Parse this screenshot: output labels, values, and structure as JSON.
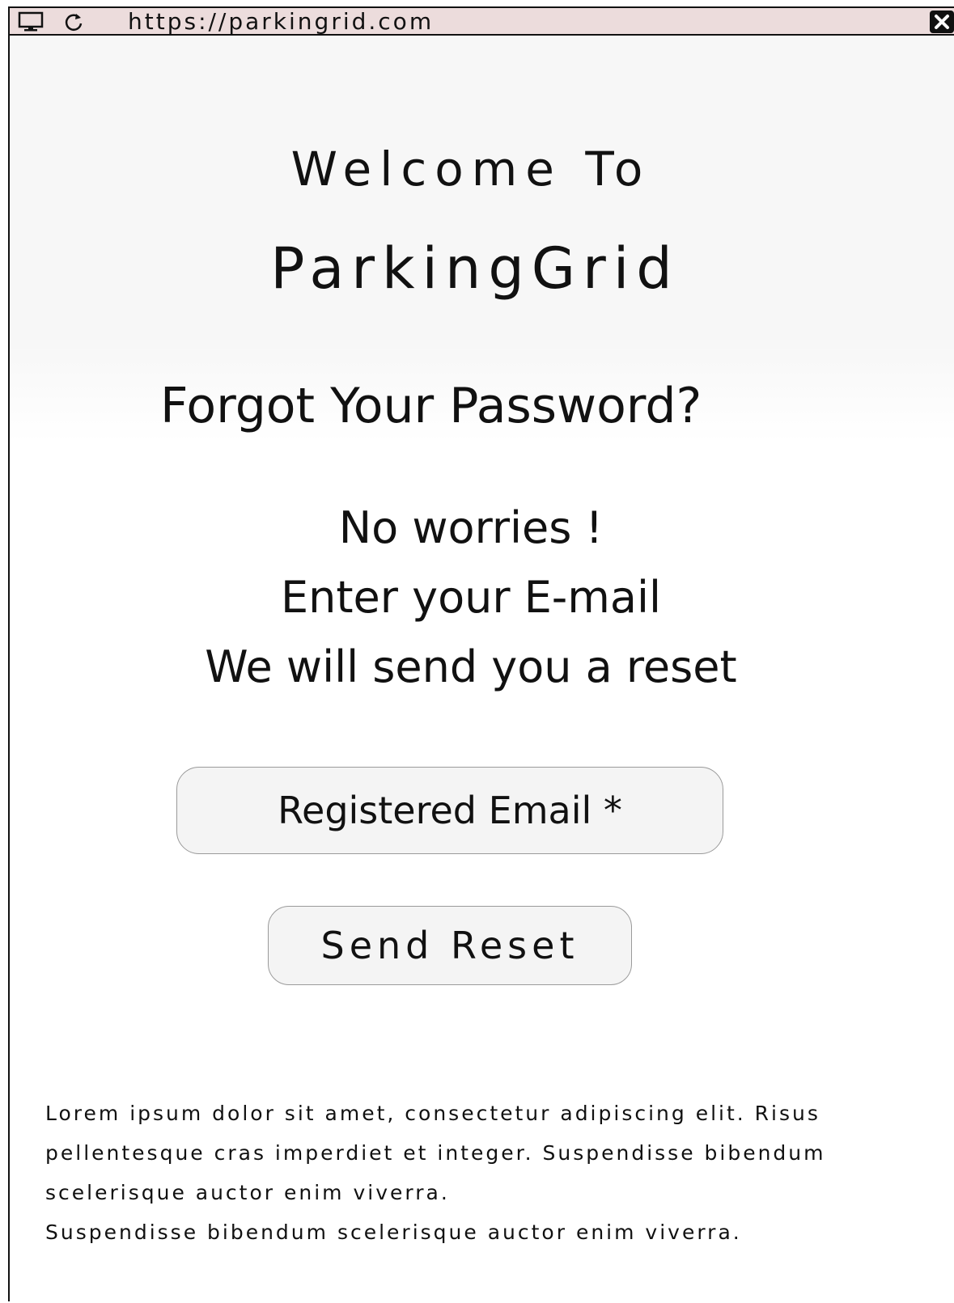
{
  "browser": {
    "url": "https://parkingrid.com",
    "icons": [
      "monitor-icon",
      "reload-icon",
      "close-icon"
    ]
  },
  "header": {
    "welcome": "Welcome To",
    "brand": "ParkingGrid"
  },
  "main": {
    "title": "Forgot Your Password?",
    "message_lines": [
      "No worries !",
      "Enter your E-mail",
      "We will send you a reset"
    ],
    "email_placeholder": "Registered Email *",
    "email_value": "",
    "send_label": "Send Reset"
  },
  "footer": {
    "paragraph": "Lorem ipsum dolor sit amet, consectetur adipiscing elit. Risus pellentesque cras imperdiet et integer. Suspendisse bibendum scelerisque auctor enim viverra.",
    "line2": "Suspendisse bibendum scelerisque auctor enim viverra."
  },
  "colors": {
    "browser_bar": "#ecdcdc",
    "page_background": "#f7f7f7",
    "input_background": "#f4f4f4",
    "input_border": "#9a9a9a",
    "text": "#111111"
  }
}
